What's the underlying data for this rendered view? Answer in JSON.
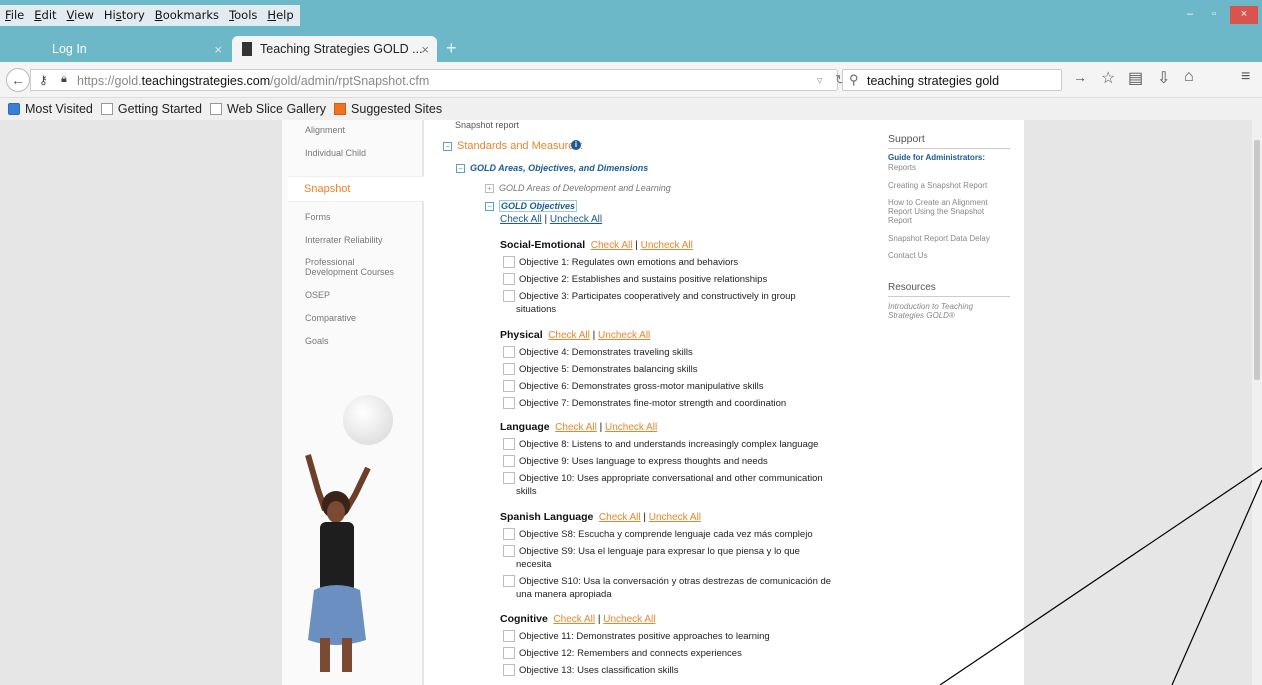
{
  "menu": [
    {
      "label": "File",
      "u": "F"
    },
    {
      "label": "Edit",
      "u": "E"
    },
    {
      "label": "View",
      "u": "V"
    },
    {
      "label": "History",
      "u": "s"
    },
    {
      "label": "Bookmarks",
      "u": "B"
    },
    {
      "label": "Tools",
      "u": "T"
    },
    {
      "label": "Help",
      "u": "H"
    }
  ],
  "tabs": {
    "login": "Log In",
    "gold": "Teaching Strategies GOLD ...",
    "close_glyph": "×",
    "new_tab_glyph": "+"
  },
  "window": {
    "minimize": "–",
    "maximize": "▫",
    "close": "×"
  },
  "url": {
    "prefix": "https://gold.",
    "domain": "teachingstrategies.com",
    "path": "/gold/admin/rptSnapshot.cfm"
  },
  "search": {
    "value": "teaching strategies gold"
  },
  "bookmarks": [
    "Most Visited",
    "Getting Started",
    "Web Slice Gallery",
    "Suggested Sites"
  ],
  "leftnav": {
    "alignment": "Alignment",
    "individual_child": "Individual Child",
    "snapshot": "Snapshot",
    "forms": "Forms",
    "interrater": "Interrater Reliability",
    "professional": "Professional",
    "dev_courses": "Development Courses",
    "osep": "OSEP",
    "comparative": "Comparative",
    "goals": "Goals"
  },
  "main": {
    "snapshot_report": "Snapshot report",
    "standards": "Standards and Measures:",
    "gold_areas_obj_dim": "GOLD Areas, Objectives, and Dimensions",
    "gold_areas_dev": "GOLD Areas of Development and Learning",
    "gold_objectives": "GOLD Objectives",
    "check_all": "Check All",
    "separator": "|",
    "uncheck_all": "Uncheck All"
  },
  "categories": [
    {
      "name": "Social-Emotional",
      "objectives": [
        [
          "Objective 1: Regulates own emotions and behaviors"
        ],
        [
          "Objective 2: Establishes and sustains positive relationships"
        ],
        [
          "Objective 3: Participates cooperatively and constructively in group",
          "situations"
        ]
      ]
    },
    {
      "name": "Physical",
      "objectives": [
        [
          "Objective 4: Demonstrates traveling skills"
        ],
        [
          "Objective 5: Demonstrates balancing skills"
        ],
        [
          "Objective 6: Demonstrates gross-motor manipulative skills"
        ],
        [
          "Objective 7: Demonstrates fine-motor strength and coordination"
        ]
      ]
    },
    {
      "name": "Language",
      "objectives": [
        [
          "Objective 8: Listens to and understands increasingly complex language"
        ],
        [
          "Objective 9: Uses language to express thoughts and needs"
        ],
        [
          "Objective 10: Uses appropriate conversational and other communication",
          "skills"
        ]
      ]
    },
    {
      "name": "Spanish Language",
      "objectives": [
        [
          "Objective S8: Escucha y comprende lenguaje cada vez más complejo"
        ],
        [
          "Objective S9: Usa el lenguaje para expresar lo que piensa y lo que",
          "necesita"
        ],
        [
          "Objective S10: Usa la conversación y otras destrezas de comunicación de",
          "una manera apropiada"
        ]
      ]
    },
    {
      "name": "Cognitive",
      "objectives": [
        [
          "Objective 11: Demonstrates positive approaches to learning"
        ],
        [
          "Objective 12: Remembers and connects experiences"
        ],
        [
          "Objective 13: Uses classification skills"
        ]
      ]
    }
  ],
  "support": {
    "heading": "Support",
    "guide_admins": "Guide for Administrators:",
    "reports": "Reports",
    "creating_snapshot": "Creating a Snapshot Report",
    "how_to_1": "How to Create an Alignment",
    "how_to_2": "Report Using the Snapshot",
    "how_to_3": "Report",
    "data_delay": "Snapshot Report Data Delay",
    "contact": "Contact Us",
    "resources": "Resources",
    "intro_1": "Introduction to Teaching",
    "intro_2": "Strategies GOLD®"
  },
  "colors": {
    "accent": "#e8852c",
    "link_blue": "#1a5a96",
    "chrome": "#6cb8c8"
  }
}
